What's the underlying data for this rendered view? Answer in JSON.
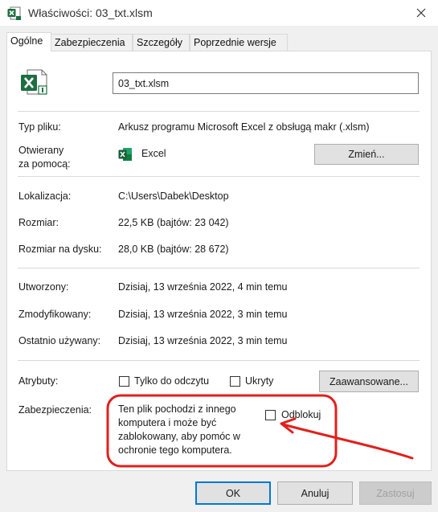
{
  "window": {
    "title": "Właściwości: 03_txt.xlsm",
    "app_icon": "excel-file-icon",
    "close_icon": "close-icon"
  },
  "tabs": [
    {
      "label": "Ogólne",
      "active": true
    },
    {
      "label": "Zabezpieczenia",
      "active": false
    },
    {
      "label": "Szczegóły",
      "active": false
    },
    {
      "label": "Poprzednie wersje",
      "active": false
    }
  ],
  "general": {
    "file_icon": "excel-macro-file-icon",
    "file_name": "03_txt.xlsm",
    "file_type_label": "Typ pliku:",
    "file_type_value": "Arkusz programu Microsoft Excel z obsługą makr (.xlsm)",
    "opens_with_label_1": "Otwierany",
    "opens_with_label_2": "za pomocą:",
    "opens_with_app_icon": "excel-icon",
    "opens_with_value": "Excel",
    "change_button": "Zmień...",
    "location_label": "Lokalizacja:",
    "location_value": "C:\\Users\\Dabek\\Desktop",
    "size_label": "Rozmiar:",
    "size_value": "22,5 KB (bajtów: 23 042)",
    "size_on_disk_label": "Rozmiar na dysku:",
    "size_on_disk_value": "28,0 KB (bajtów: 28 672)",
    "created_label": "Utworzony:",
    "created_value": "Dzisiaj, 13 września 2022, 4 min temu",
    "modified_label": "Zmodyfikowany:",
    "modified_value": "Dzisiaj, 13 września 2022, 3 min temu",
    "accessed_label": "Ostatnio używany:",
    "accessed_value": "Dzisiaj, 13 września 2022, 3 min temu",
    "attributes_label": "Atrybuty:",
    "readonly_label": "Tylko do odczytu",
    "readonly_checked": false,
    "hidden_label": "Ukryty",
    "hidden_checked": false,
    "advanced_button": "Zaawansowane...",
    "security_label": "Zabezpieczenia:",
    "security_line_1": "Ten plik pochodzi z innego",
    "security_line_2": "komputera i może być",
    "security_line_3": "zablokowany, aby pomóc w",
    "security_line_4": "ochronie tego komputera.",
    "unblock_label": "Odblokuj",
    "unblock_checked": false,
    "annotation_color": "#e0201c"
  },
  "footer": {
    "ok_button": "OK",
    "cancel_button": "Anuluj",
    "apply_button": "Zastosuj"
  }
}
